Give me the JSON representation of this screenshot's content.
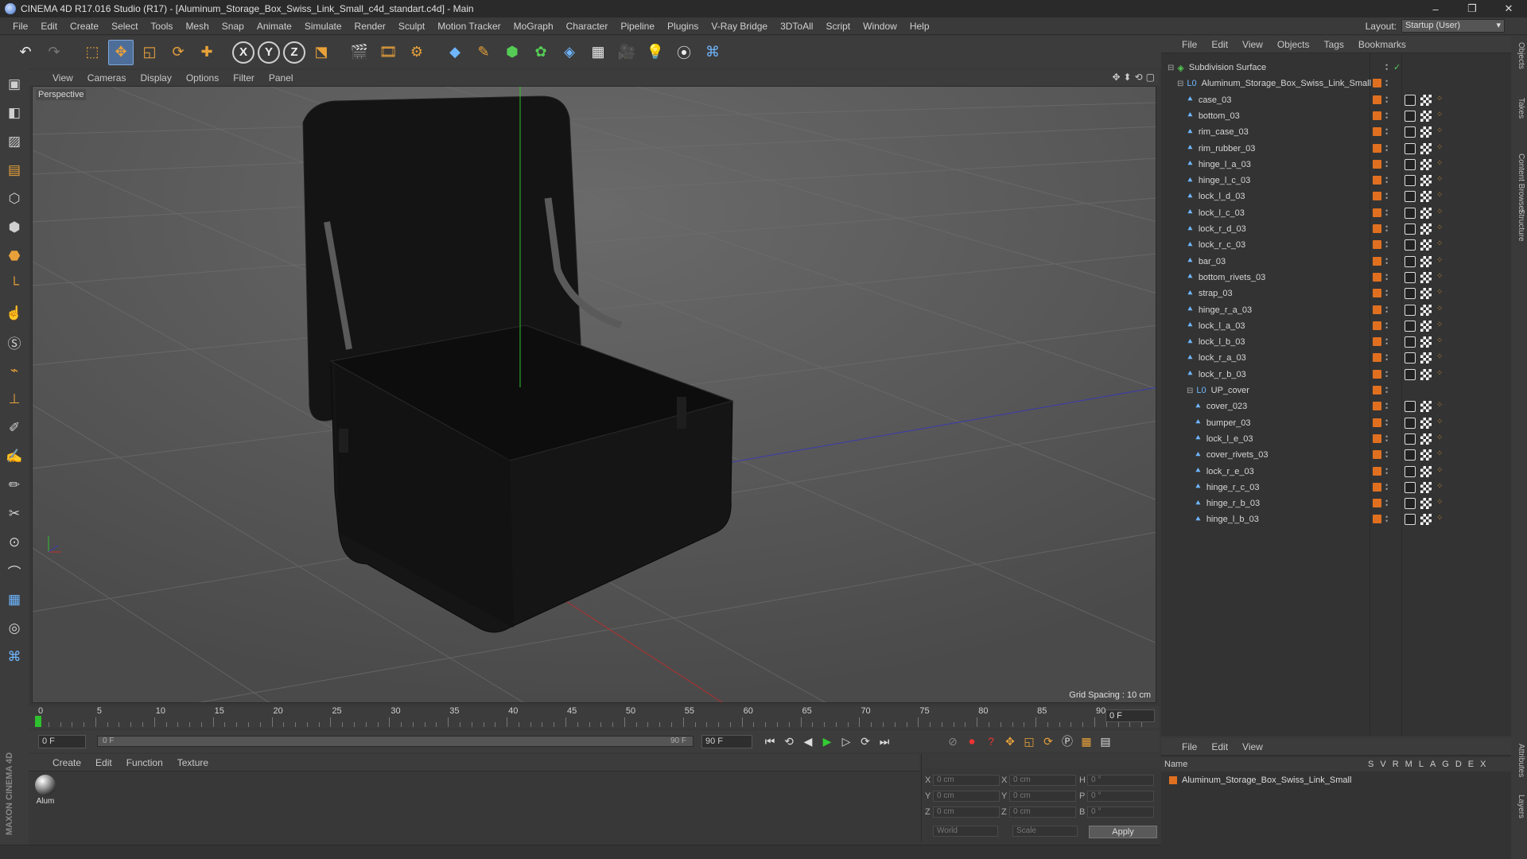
{
  "window": {
    "title": "CINEMA 4D R17.016 Studio (R17) - [Aluminum_Storage_Box_Swiss_Link_Small_c4d_standart.c4d] - Main"
  },
  "menu": [
    "File",
    "Edit",
    "Create",
    "Select",
    "Tools",
    "Mesh",
    "Snap",
    "Animate",
    "Simulate",
    "Render",
    "Sculpt",
    "Motion Tracker",
    "MoGraph",
    "Character",
    "Pipeline",
    "Plugins",
    "V-Ray Bridge",
    "3DToAll",
    "Script",
    "Window",
    "Help"
  ],
  "layout": {
    "label": "Layout:",
    "value": "Startup (User)"
  },
  "viewport": {
    "menu": [
      "View",
      "Cameras",
      "Display",
      "Options",
      "Filter",
      "Panel"
    ],
    "label": "Perspective",
    "grid_spacing": "Grid Spacing : 10 cm"
  },
  "timeline": {
    "ticks": [
      "0",
      "5",
      "10",
      "15",
      "20",
      "25",
      "30",
      "35",
      "40",
      "45",
      "50",
      "55",
      "60",
      "65",
      "70",
      "75",
      "80",
      "85",
      "90"
    ],
    "current_frame": "0 F",
    "start": "0 F",
    "slider_left": "0 F",
    "slider_right": "90 F",
    "end": "90 F"
  },
  "material": {
    "menu": [
      "Create",
      "Edit",
      "Function",
      "Texture"
    ],
    "name": "Alum"
  },
  "coords": {
    "rows": [
      {
        "a": "X",
        "av": "0 cm",
        "b": "X",
        "bv": "0 cm",
        "c": "H",
        "cv": "0 °"
      },
      {
        "a": "Y",
        "av": "0 cm",
        "b": "Y",
        "bv": "0 cm",
        "c": "P",
        "cv": "0 °"
      },
      {
        "a": "Z",
        "av": "0 cm",
        "b": "Z",
        "bv": "0 cm",
        "c": "B",
        "cv": "0 °"
      }
    ],
    "world": "World",
    "scale": "Scale",
    "apply": "Apply"
  },
  "objects": {
    "menu": [
      "File",
      "Edit",
      "View",
      "Objects",
      "Tags",
      "Bookmarks"
    ],
    "items": [
      {
        "name": "Subdivision Surface",
        "level": 0,
        "tags": false
      },
      {
        "name": "Aluminum_Storage_Box_Swiss_Link_Small",
        "level": 1,
        "tags": false
      },
      {
        "name": "case_03",
        "level": 2,
        "tags": true
      },
      {
        "name": "bottom_03",
        "level": 2,
        "tags": true
      },
      {
        "name": "rim_case_03",
        "level": 2,
        "tags": true
      },
      {
        "name": "rim_rubber_03",
        "level": 2,
        "tags": true
      },
      {
        "name": "hinge_l_a_03",
        "level": 2,
        "tags": true
      },
      {
        "name": "hinge_l_c_03",
        "level": 2,
        "tags": true
      },
      {
        "name": "lock_l_d_03",
        "level": 2,
        "tags": true
      },
      {
        "name": "lock_l_c_03",
        "level": 2,
        "tags": true
      },
      {
        "name": "lock_r_d_03",
        "level": 2,
        "tags": true
      },
      {
        "name": "lock_r_c_03",
        "level": 2,
        "tags": true
      },
      {
        "name": "bar_03",
        "level": 2,
        "tags": true
      },
      {
        "name": "bottom_rivets_03",
        "level": 2,
        "tags": true
      },
      {
        "name": "strap_03",
        "level": 2,
        "tags": true
      },
      {
        "name": "hinge_r_a_03",
        "level": 2,
        "tags": true
      },
      {
        "name": "lock_l_a_03",
        "level": 2,
        "tags": true
      },
      {
        "name": "lock_l_b_03",
        "level": 2,
        "tags": true
      },
      {
        "name": "lock_r_a_03",
        "level": 2,
        "tags": true
      },
      {
        "name": "lock_r_b_03",
        "level": 2,
        "tags": true
      },
      {
        "name": "UP_cover",
        "level": 2,
        "tags": false
      },
      {
        "name": "cover_023",
        "level": 3,
        "tags": true
      },
      {
        "name": "bumper_03",
        "level": 3,
        "tags": true
      },
      {
        "name": "lock_l_e_03",
        "level": 3,
        "tags": true
      },
      {
        "name": "cover_rivets_03",
        "level": 3,
        "tags": true
      },
      {
        "name": "lock_r_e_03",
        "level": 3,
        "tags": true
      },
      {
        "name": "hinge_r_c_03",
        "level": 3,
        "tags": true
      },
      {
        "name": "hinge_r_b_03",
        "level": 3,
        "tags": true
      },
      {
        "name": "hinge_l_b_03",
        "level": 3,
        "tags": true
      }
    ]
  },
  "right_tabs": [
    "Objects",
    "Takes",
    "Content Browser",
    "Structure"
  ],
  "right_tabs_bottom": [
    "Attributes",
    "Layers"
  ],
  "layers": {
    "menu": [
      "File",
      "Edit",
      "View"
    ],
    "header": "Name",
    "columns": [
      "S",
      "V",
      "R",
      "M",
      "L",
      "A",
      "G",
      "D",
      "E",
      "X"
    ],
    "row": "Aluminum_Storage_Box_Swiss_Link_Small"
  },
  "brand": "MAXON CINEMA 4D",
  "colors": {
    "accent": "#e07020",
    "selection": "#4e6e9a",
    "axis_y": "#22c022",
    "axis_x": "#c03030",
    "axis_z": "#3a3ac0"
  }
}
